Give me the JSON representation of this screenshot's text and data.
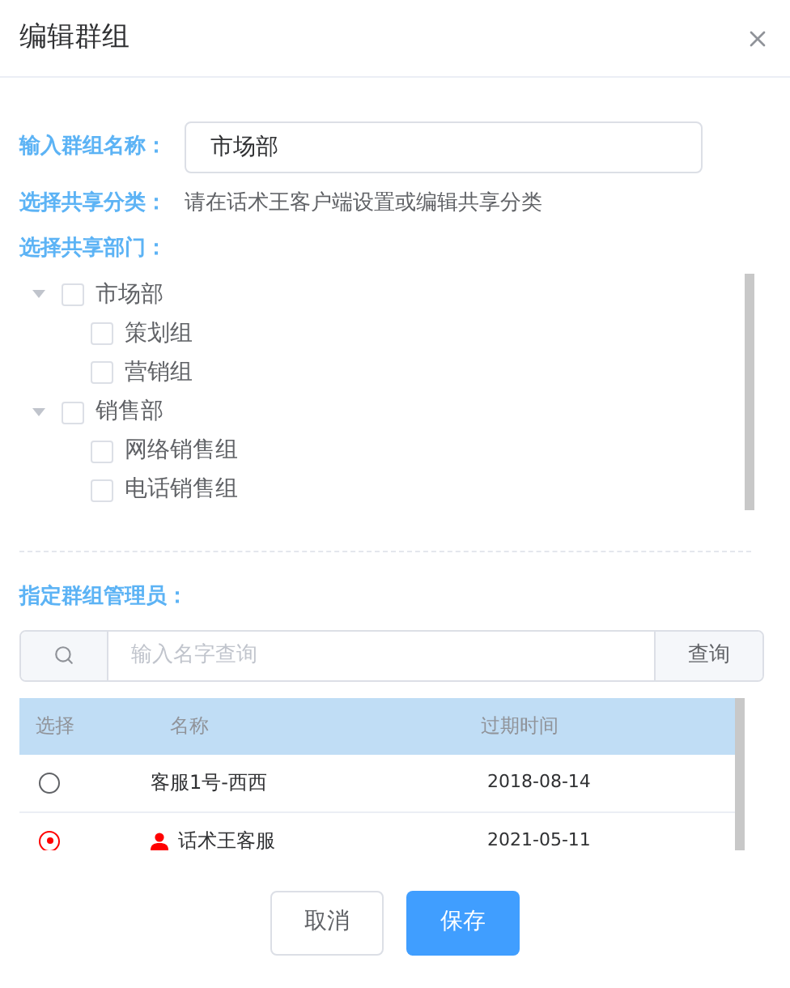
{
  "dialog": {
    "title": "编辑群组"
  },
  "name_field": {
    "label": "输入群组名称：",
    "value": "市场部"
  },
  "share_category": {
    "label": "选择共享分类：",
    "text": "请在话术王客户端设置或编辑共享分类"
  },
  "departments": {
    "label": "选择共享部门：",
    "tree": [
      {
        "label": "市场部",
        "checked": false,
        "expanded": true,
        "children": [
          {
            "label": "策划组",
            "checked": false
          },
          {
            "label": "营销组",
            "checked": false
          }
        ]
      },
      {
        "label": "销售部",
        "checked": false,
        "expanded": true,
        "children": [
          {
            "label": "网络销售组",
            "checked": false
          },
          {
            "label": "电话销售组",
            "checked": false
          }
        ]
      }
    ]
  },
  "admins": {
    "label": "指定群组管理员：",
    "search": {
      "placeholder": "输入名字查询",
      "button": "查询"
    },
    "columns": [
      "选择",
      "名称",
      "过期时间"
    ],
    "rows": [
      {
        "selected": false,
        "owner": false,
        "name": "客服1号-西西",
        "expires": "2018-08-14"
      },
      {
        "selected": true,
        "owner": true,
        "name": "话术王客服",
        "expires": "2021-05-11"
      }
    ]
  },
  "buttons": {
    "cancel": "取消",
    "save": "保存"
  }
}
